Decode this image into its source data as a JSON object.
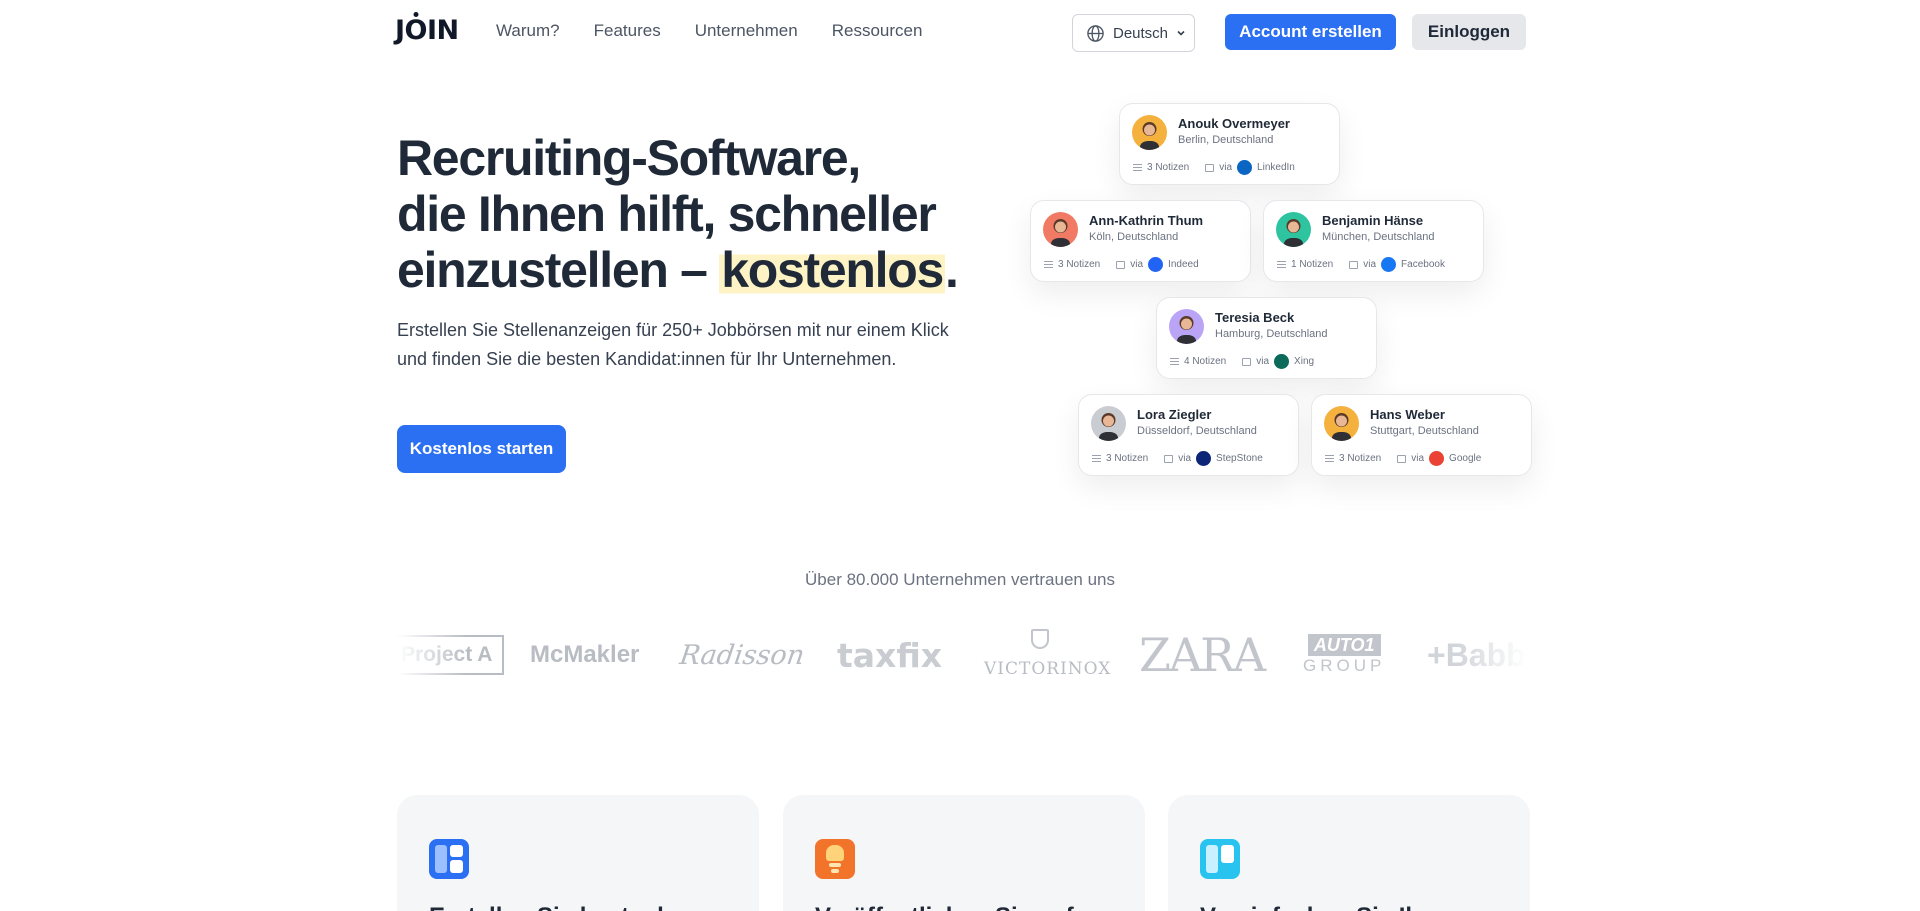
{
  "nav": {
    "logo": "JOIN",
    "links": [
      "Warum?",
      "Features",
      "Unternehmen",
      "Ressourcen"
    ],
    "language": "Deutsch",
    "create_account": "Account erstellen",
    "login": "Einloggen"
  },
  "hero": {
    "title_lines": [
      "Recruiting-Software,",
      "die Ihnen hilft, schneller",
      "einzustellen – "
    ],
    "title_highlight": "kostenlos",
    "title_end": ".",
    "subtitle": "Erstellen Sie Stellenanzeigen für 250+ Jobbörsen mit nur einem Klick und finden Sie die besten Kandidat:innen für Ihr Unternehmen.",
    "cta": "Kostenlos starten"
  },
  "candidates": [
    {
      "name": "Anouk Overmeyer",
      "location": "Berlin, Deutschland",
      "notes": "3 Notizen",
      "via": "via",
      "source": "LinkedIn",
      "source_color": "#0a66c2",
      "source_icon": "linkedin-icon",
      "avatar_color": "#f5b13d"
    },
    {
      "name": "Ann-Kathrin Thum",
      "location": "Köln, Deutschland",
      "notes": "3 Notizen",
      "via": "via",
      "source": "Indeed",
      "source_color": "#2164f3",
      "source_icon": "indeed-icon",
      "avatar_color": "#f07a63"
    },
    {
      "name": "Benjamin Hänse",
      "location": "München, Deutschland",
      "notes": "1 Notizen",
      "via": "via",
      "source": "Facebook",
      "source_color": "#1877f2",
      "source_icon": "facebook-icon",
      "avatar_color": "#2ec4a0"
    },
    {
      "name": "Teresia Beck",
      "location": "Hamburg, Deutschland",
      "notes": "4 Notizen",
      "via": "via",
      "source": "Xing",
      "source_color": "#0b6a5a",
      "source_icon": "xing-icon",
      "avatar_color": "#b9a4f5"
    },
    {
      "name": "Lora Ziegler",
      "location": "Düsseldorf, Deutschland",
      "notes": "3 Notizen",
      "via": "via",
      "source": "StepStone",
      "source_color": "#0c2577",
      "source_icon": "stepstone-icon",
      "avatar_color": "#c9ccd1"
    },
    {
      "name": "Hans Weber",
      "location": "Stuttgart, Deutschland",
      "notes": "3 Notizen",
      "via": "via",
      "source": "Google",
      "source_color": "#ea4335",
      "source_icon": "google-icon",
      "avatar_color": "#f5b13d"
    }
  ],
  "trust": {
    "text": "Über 80.000 Unternehmen vertrauen uns",
    "logos": [
      "Project A",
      "McMakler",
      "Radisson",
      "taxfix",
      "VICTORINOX",
      "ZARA",
      "AUTO1",
      "GROUP",
      "+Babbel"
    ]
  },
  "features": [
    {
      "title": "Erstellen Sie kostenlos",
      "icon": "layout-icon",
      "color": "#2b6ff2"
    },
    {
      "title": "Veröffentlichen Sie auf",
      "icon": "publish-icon",
      "color": "#f2742b"
    },
    {
      "title": "Vereinfachen Sie Ihr",
      "icon": "board-icon",
      "color": "#29c3f0"
    }
  ],
  "colors": {
    "accent": "#2b6ff2",
    "highlight": "#fdf3c4"
  }
}
